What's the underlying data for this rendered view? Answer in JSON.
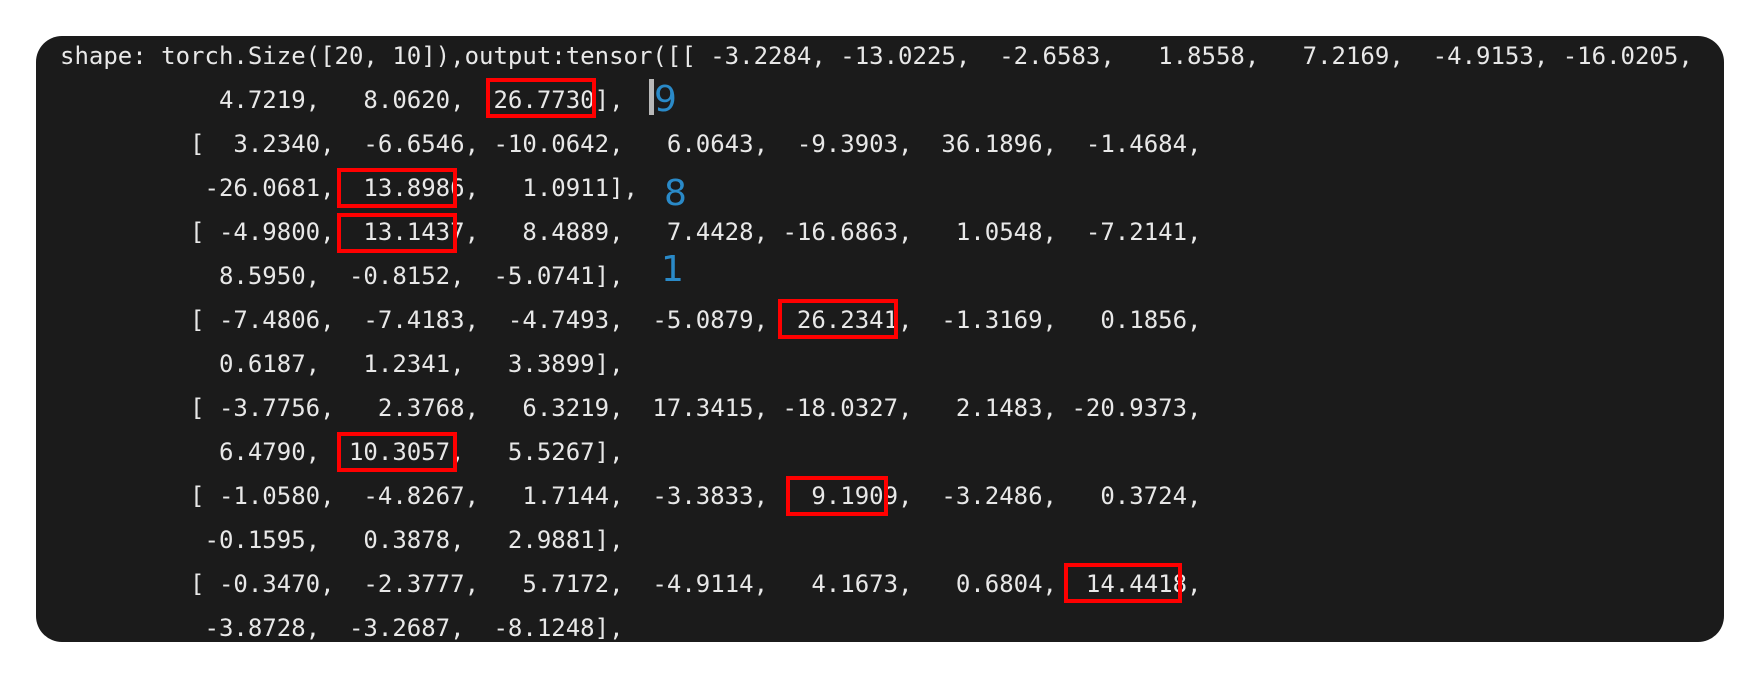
{
  "terminal": {
    "lines": [
      "shape: torch.Size([20, 10]),output:tensor([[ -3.2284, -13.0225,  -2.6583,   1.8558,   7.2169,  -4.9153, -16.0205,",
      "           4.7219,   8.0620,  26.7730],",
      "         [  3.2340,  -6.6546, -10.0642,   6.0643,  -9.3903,  36.1896,  -1.4684,",
      "          -26.0681,  13.8986,   1.0911],",
      "         [ -4.9800,  13.1437,   8.4889,   7.4428, -16.6863,   1.0548,  -7.2141,",
      "           8.5950,  -0.8152,  -5.0741],",
      "         [ -7.4806,  -7.4183,  -4.7493,  -5.0879,  26.2341,  -1.3169,   0.1856,",
      "           0.6187,   1.2341,   3.3899],",
      "         [ -3.7756,   2.3768,   6.3219,  17.3415, -18.0327,   2.1483, -20.9373,",
      "           6.4790,  10.3057,   5.5267],",
      "         [ -1.0580,  -4.8267,   1.7144,  -3.3833,   9.1909,  -3.2486,   0.3724,",
      "          -0.1595,   0.3878,   2.9881],",
      "         [ -0.3470,  -2.3777,   5.7172,  -4.9114,   4.1673,   0.6804,  14.4418,",
      "          -3.8728,  -3.2687,  -8.1248],"
    ],
    "annotations": [
      "9",
      "8",
      "1"
    ],
    "highlight_color": "#ff0000",
    "annotation_color": "#2a8ac8",
    "background_color": "#1b1b1b",
    "text_color": "#e8e8e8"
  }
}
